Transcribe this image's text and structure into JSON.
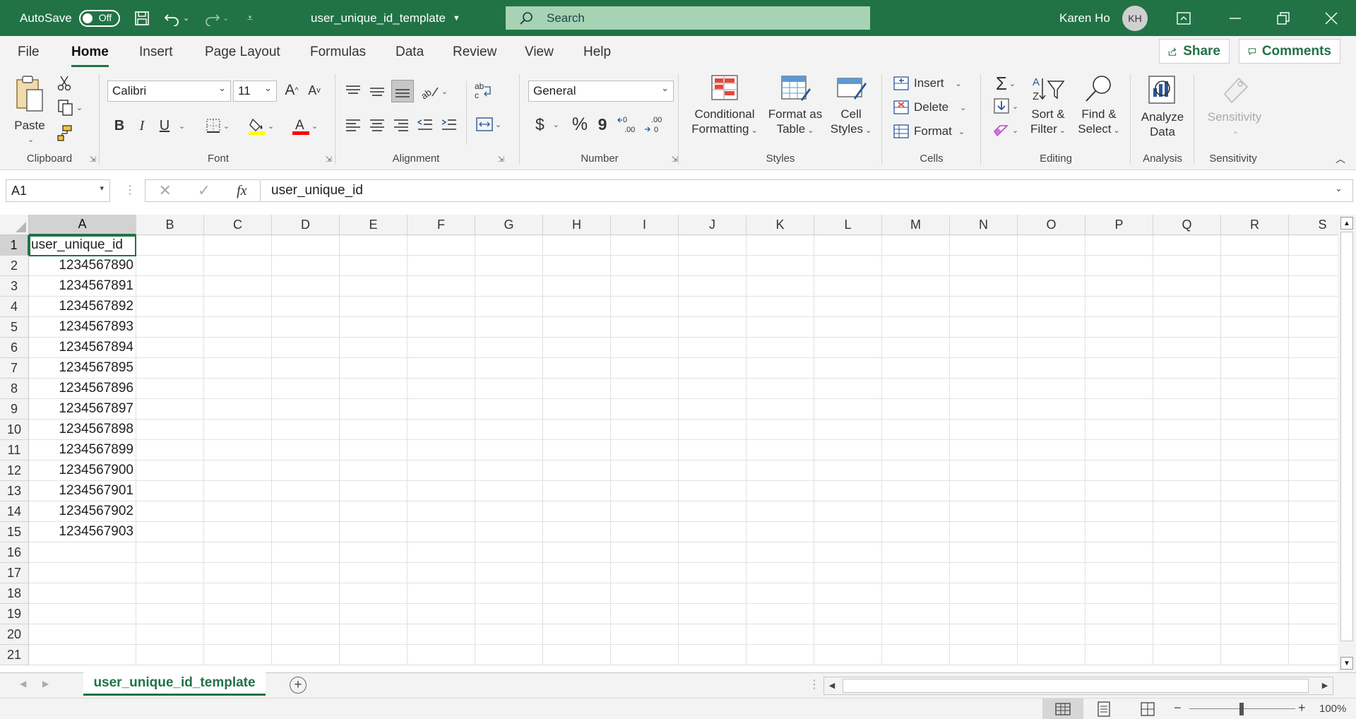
{
  "titlebar": {
    "autosave_label": "AutoSave",
    "autosave_state": "Off",
    "filename": "user_unique_id_template",
    "search_placeholder": "Search",
    "user_name": "Karen Ho",
    "user_initials": "KH"
  },
  "tabs": [
    "File",
    "Home",
    "Insert",
    "Page Layout",
    "Formulas",
    "Data",
    "Review",
    "View",
    "Help"
  ],
  "active_tab": "Home",
  "share_label": "Share",
  "comments_label": "Comments",
  "ribbon": {
    "clipboard": {
      "label": "Clipboard",
      "paste": "Paste"
    },
    "font": {
      "label": "Font",
      "name": "Calibri",
      "size": "11",
      "bold": "B",
      "italic": "I",
      "underline": "U"
    },
    "alignment": {
      "label": "Alignment"
    },
    "number": {
      "label": "Number",
      "format": "General",
      "currency": "$",
      "percent": "%",
      "comma": "9"
    },
    "styles": {
      "label": "Styles",
      "conditional_line1": "Conditional",
      "conditional_line2": "Formatting",
      "format_table_line1": "Format as",
      "format_table_line2": "Table",
      "cell_styles_line1": "Cell",
      "cell_styles_line2": "Styles"
    },
    "cells": {
      "label": "Cells",
      "insert": "Insert",
      "delete": "Delete",
      "format": "Format"
    },
    "editing": {
      "label": "Editing",
      "sort_line1": "Sort &",
      "sort_line2": "Filter",
      "find_line1": "Find &",
      "find_line2": "Select"
    },
    "analysis": {
      "label": "Analysis",
      "analyze_line1": "Analyze",
      "analyze_line2": "Data"
    },
    "sensitivity": {
      "label": "Sensitivity",
      "button": "Sensitivity"
    }
  },
  "formula_bar": {
    "name_box": "A1",
    "fx": "fx",
    "content": "user_unique_id"
  },
  "columns": [
    "A",
    "B",
    "C",
    "D",
    "E",
    "F",
    "G",
    "H",
    "I",
    "J",
    "K",
    "L",
    "M",
    "N",
    "O",
    "P",
    "Q",
    "R",
    "S"
  ],
  "rows": [
    "1",
    "2",
    "3",
    "4",
    "5",
    "6",
    "7",
    "8",
    "9",
    "10",
    "11",
    "12",
    "13",
    "14",
    "15",
    "16",
    "17",
    "18",
    "19",
    "20",
    "21"
  ],
  "cells_A": [
    "user_unique_id",
    "1234567890",
    "1234567891",
    "1234567892",
    "1234567893",
    "1234567894",
    "1234567895",
    "1234567896",
    "1234567897",
    "1234567898",
    "1234567899",
    "1234567900",
    "1234567901",
    "1234567902",
    "1234567903"
  ],
  "sheet_tab": "user_unique_id_template",
  "zoom": "100%",
  "colors": {
    "accent": "#217346",
    "search_bg": "#a6d3b4"
  }
}
